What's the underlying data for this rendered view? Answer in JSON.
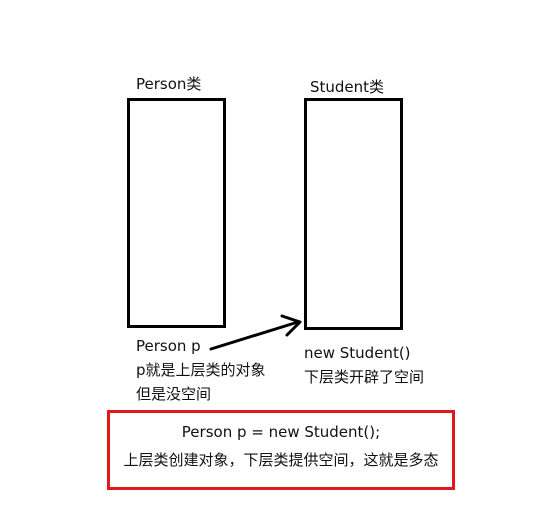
{
  "person": {
    "title": "Person类",
    "caption_line1": "Person p",
    "caption_line2": "p就是上层类的对象",
    "caption_line3": "但是没空间"
  },
  "student": {
    "title": "Student类",
    "caption_line1": "new Student()",
    "caption_line2": "下层类开辟了空间"
  },
  "summary": {
    "code": "Person p = new Student();",
    "explanation": "上层类创建对象，下层类提供空间，这就是多态"
  },
  "colors": {
    "box_border": "#000000",
    "summary_border": "#e0191f"
  }
}
